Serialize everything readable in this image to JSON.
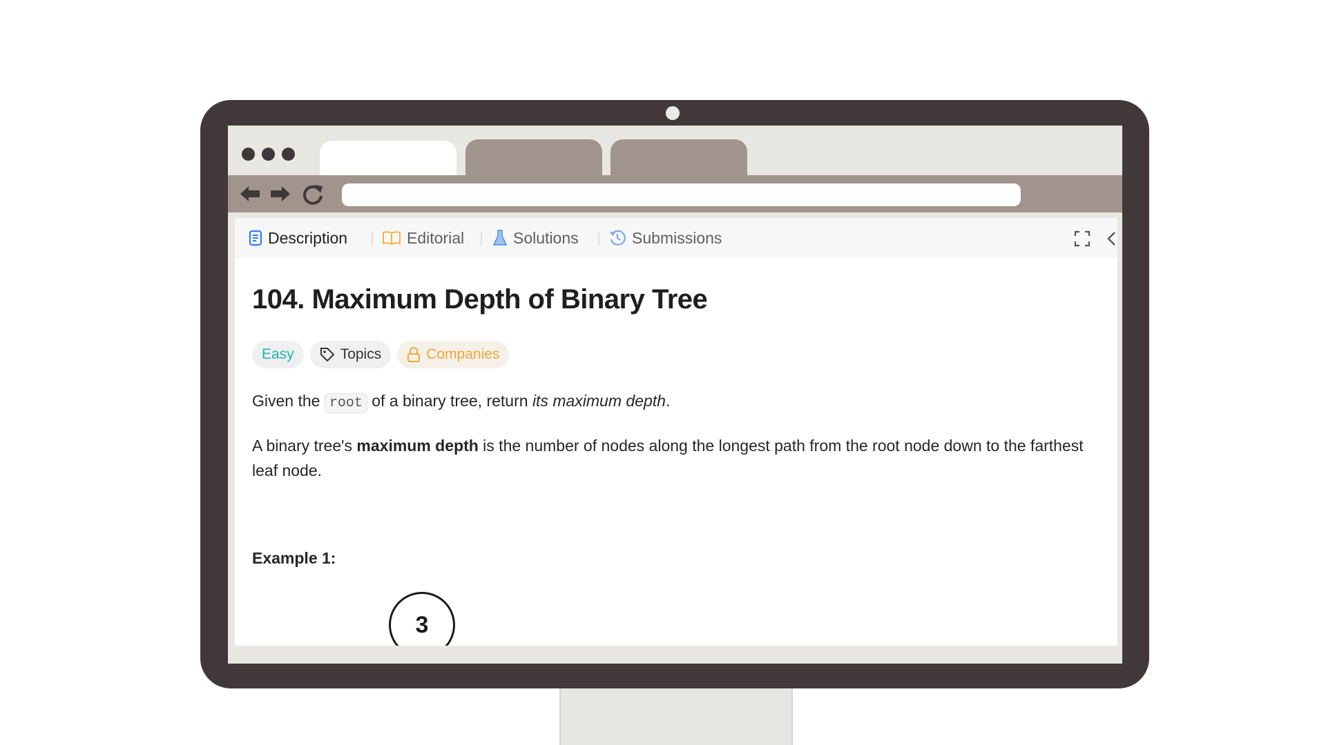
{
  "colors": {
    "bezel": "#413939",
    "chrome_bar": "#a0948d",
    "easy": "#1fb4ad",
    "companies": "#f0a63a",
    "description_icon": "#2f80ed"
  },
  "page_tabs": [
    {
      "label": "Description",
      "icon": "description-icon"
    },
    {
      "label": "Editorial",
      "icon": "book-icon"
    },
    {
      "label": "Solutions",
      "icon": "flask-icon"
    },
    {
      "label": "Submissions",
      "icon": "history-icon"
    }
  ],
  "problem": {
    "title": "104. Maximum Depth of Binary Tree",
    "badges": {
      "difficulty": "Easy",
      "topics": "Topics",
      "companies": "Companies"
    },
    "para1": {
      "before": "Given the ",
      "code": "root",
      "middle": " of a binary tree, return ",
      "emphasis": "its maximum depth",
      "after": "."
    },
    "para2": {
      "before": "A binary tree's ",
      "strong": "maximum depth",
      "after": " is the number of nodes along the longest path from the root node down to the farthest leaf node."
    },
    "example_heading": "Example 1:",
    "tree_root_value": "3"
  }
}
